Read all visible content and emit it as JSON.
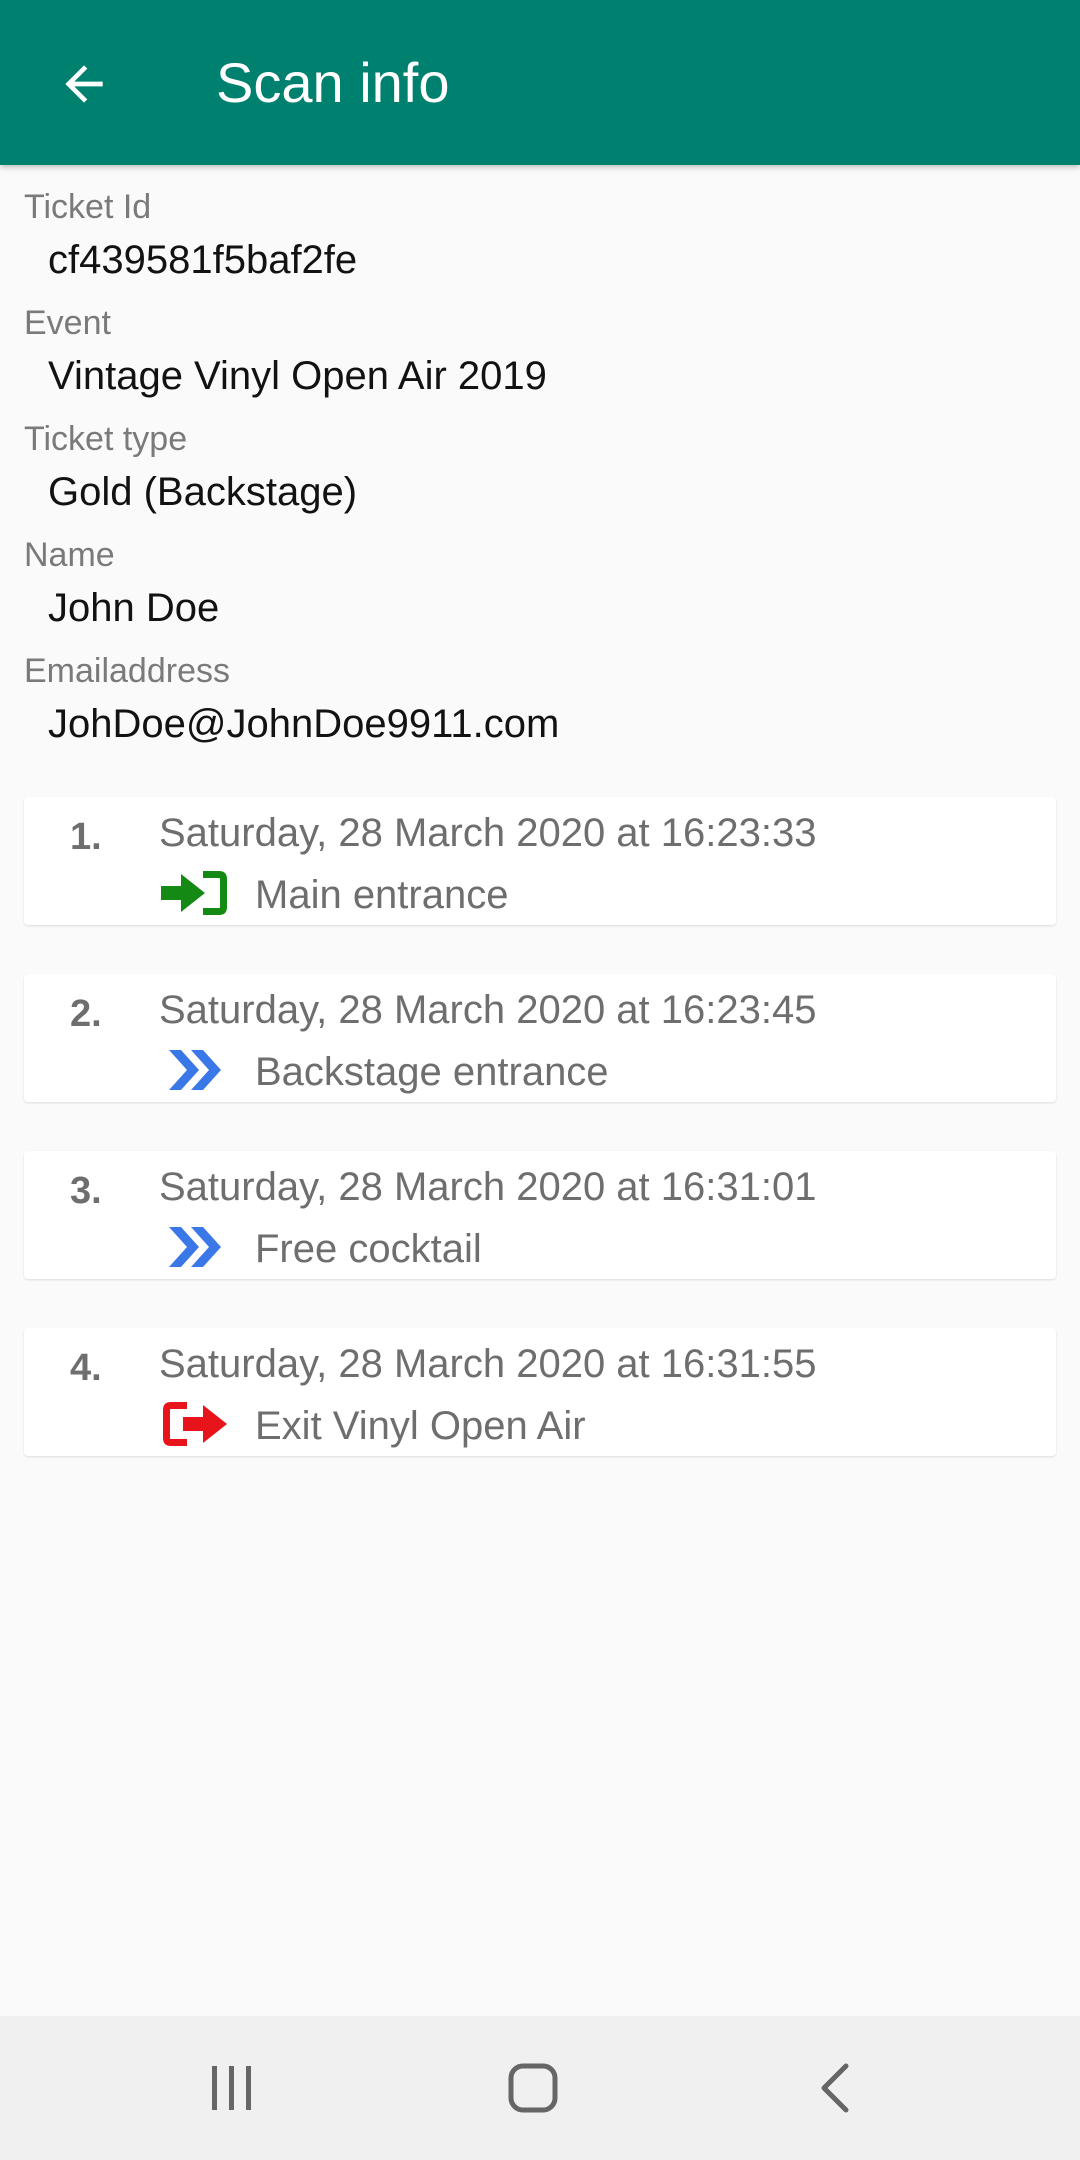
{
  "app_bar": {
    "title": "Scan info",
    "back_icon": "arrow-left-icon",
    "background": "#00806f"
  },
  "ticket": {
    "fields": [
      {
        "label": "Ticket Id",
        "value": "cf439581f5baf2fe"
      },
      {
        "label": "Event",
        "value": "Vintage Vinyl Open Air 2019"
      },
      {
        "label": "Ticket type",
        "value": "Gold (Backstage)"
      },
      {
        "label": "Name",
        "value": "John Doe"
      },
      {
        "label": "Emailaddress",
        "value": "JohDoe@JohnDoe9911.com"
      }
    ]
  },
  "scans": [
    {
      "number": "1.",
      "time": "Saturday, 28 March 2020 at 16:23:33",
      "icon": "sign-in-icon",
      "icon_color": "#148a14",
      "place": "Main entrance"
    },
    {
      "number": "2.",
      "time": "Saturday, 28 March 2020 at 16:23:45",
      "icon": "double-chevron-right-icon",
      "icon_color": "#3b78e7",
      "place": "Backstage entrance"
    },
    {
      "number": "3.",
      "time": "Saturday, 28 March 2020 at 16:31:01",
      "icon": "double-chevron-right-icon",
      "icon_color": "#3b78e7",
      "place": "Free cocktail"
    },
    {
      "number": "4.",
      "time": "Saturday, 28 March 2020 at 16:31:55",
      "icon": "sign-out-icon",
      "icon_color": "#e8141c",
      "place": "Exit Vinyl Open Air"
    }
  ],
  "nav_bar": {
    "items": [
      "recent-apps-icon",
      "home-icon",
      "back-chevron-icon"
    ]
  }
}
